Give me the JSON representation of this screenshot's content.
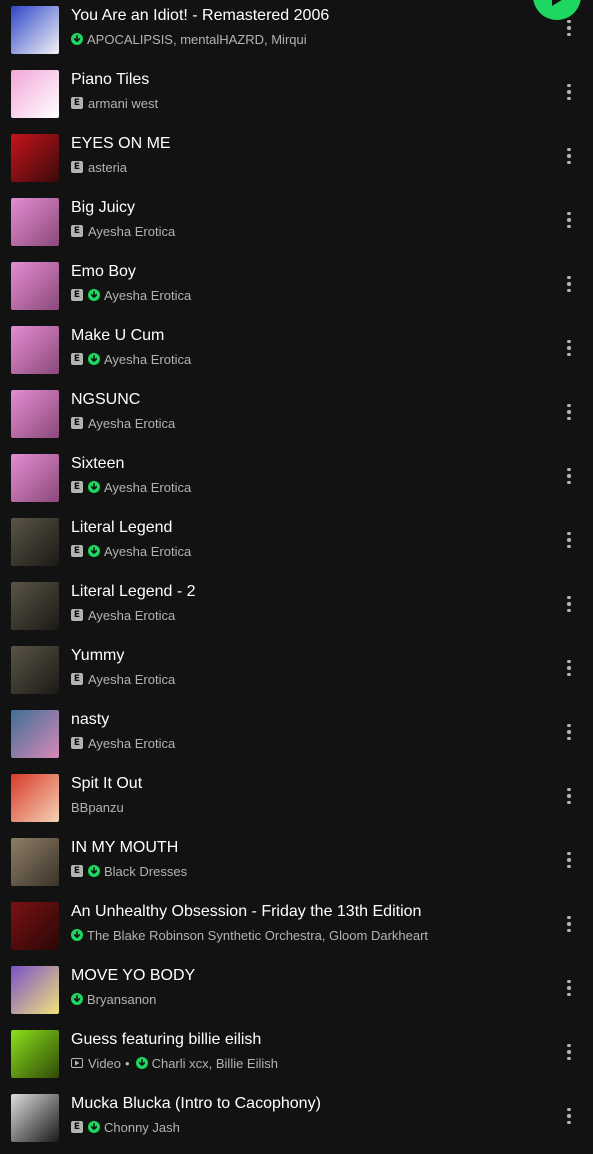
{
  "colors": {
    "background": "#121212",
    "primary_text": "#ffffff",
    "secondary_text": "#b3b3b3",
    "accent": "#1ed760"
  },
  "play_button": {
    "icon": "play-icon"
  },
  "tracks": [
    {
      "title": "You Are an Idiot! - Remastered 2006",
      "artists": "APOCALIPSIS, mentalHAZRD, Mirqui",
      "explicit": false,
      "downloaded": true,
      "video": false,
      "art_color": "#2f46c9",
      "art_color2": "#f4f4f4"
    },
    {
      "title": "Piano Tiles",
      "artists": "armani west",
      "explicit": true,
      "downloaded": false,
      "video": false,
      "art_color": "#f2a6d8",
      "art_color2": "#ffffff"
    },
    {
      "title": "EYES ON ME",
      "artists": "asteria",
      "explicit": true,
      "downloaded": false,
      "video": false,
      "art_color": "#c8141c",
      "art_color2": "#3a0a0a"
    },
    {
      "title": "Big Juicy",
      "artists": "Ayesha Erotica",
      "explicit": true,
      "downloaded": false,
      "video": false,
      "art_color": "#e58cd2",
      "art_color2": "#8a4a7a"
    },
    {
      "title": "Emo Boy",
      "artists": "Ayesha Erotica",
      "explicit": true,
      "downloaded": true,
      "video": false,
      "art_color": "#e58cd2",
      "art_color2": "#8a4a7a"
    },
    {
      "title": "Make U Cum",
      "artists": "Ayesha Erotica",
      "explicit": true,
      "downloaded": true,
      "video": false,
      "art_color": "#e58cd2",
      "art_color2": "#8a4a7a"
    },
    {
      "title": "NGSUNC",
      "artists": "Ayesha Erotica",
      "explicit": true,
      "downloaded": false,
      "video": false,
      "art_color": "#e58cd2",
      "art_color2": "#8a4a7a"
    },
    {
      "title": "Sixteen",
      "artists": "Ayesha Erotica",
      "explicit": true,
      "downloaded": true,
      "video": false,
      "art_color": "#e58cd2",
      "art_color2": "#8a4a7a"
    },
    {
      "title": "Literal Legend",
      "artists": "Ayesha Erotica",
      "explicit": true,
      "downloaded": true,
      "video": false,
      "art_color": "#5a5446",
      "art_color2": "#1c1a16"
    },
    {
      "title": "Literal Legend - 2",
      "artists": "Ayesha Erotica",
      "explicit": true,
      "downloaded": false,
      "video": false,
      "art_color": "#5a5446",
      "art_color2": "#1c1a16"
    },
    {
      "title": "Yummy",
      "artists": "Ayesha Erotica",
      "explicit": true,
      "downloaded": false,
      "video": false,
      "art_color": "#5a5446",
      "art_color2": "#1c1a16"
    },
    {
      "title": "nasty",
      "artists": "Ayesha Erotica",
      "explicit": true,
      "downloaded": false,
      "video": false,
      "art_color": "#3f6f96",
      "art_color2": "#d889b8"
    },
    {
      "title": "Spit It Out",
      "artists": "BBpanzu",
      "explicit": false,
      "downloaded": false,
      "video": false,
      "art_color": "#d83a2b",
      "art_color2": "#f5d3b6"
    },
    {
      "title": "IN MY MOUTH",
      "artists": "Black Dresses",
      "explicit": true,
      "downloaded": true,
      "video": false,
      "art_color": "#8e7e66",
      "art_color2": "#3b332a"
    },
    {
      "title": "An Unhealthy Obsession - Friday the 13th Edition",
      "artists": "The Blake Robinson Synthetic Orchestra, Gloom Darkheart",
      "explicit": false,
      "downloaded": true,
      "video": false,
      "art_color": "#7a1214",
      "art_color2": "#2a0606"
    },
    {
      "title": "MOVE YO BODY",
      "artists": "Bryansanon",
      "explicit": false,
      "downloaded": true,
      "video": false,
      "art_color": "#7a52c9",
      "art_color2": "#f2e27a"
    },
    {
      "title": "Guess featuring billie eilish",
      "artists": "Charli xcx, Billie Eilish",
      "explicit": false,
      "downloaded": true,
      "video": true,
      "video_label": "Video",
      "art_color": "#8ce01c",
      "art_color2": "#2f4a08"
    },
    {
      "title": "Mucka Blucka (Intro to Cacophony)",
      "artists": "Chonny Jash",
      "explicit": true,
      "downloaded": true,
      "video": false,
      "art_color": "#dcdcdc",
      "art_color2": "#1a1a1a"
    }
  ]
}
